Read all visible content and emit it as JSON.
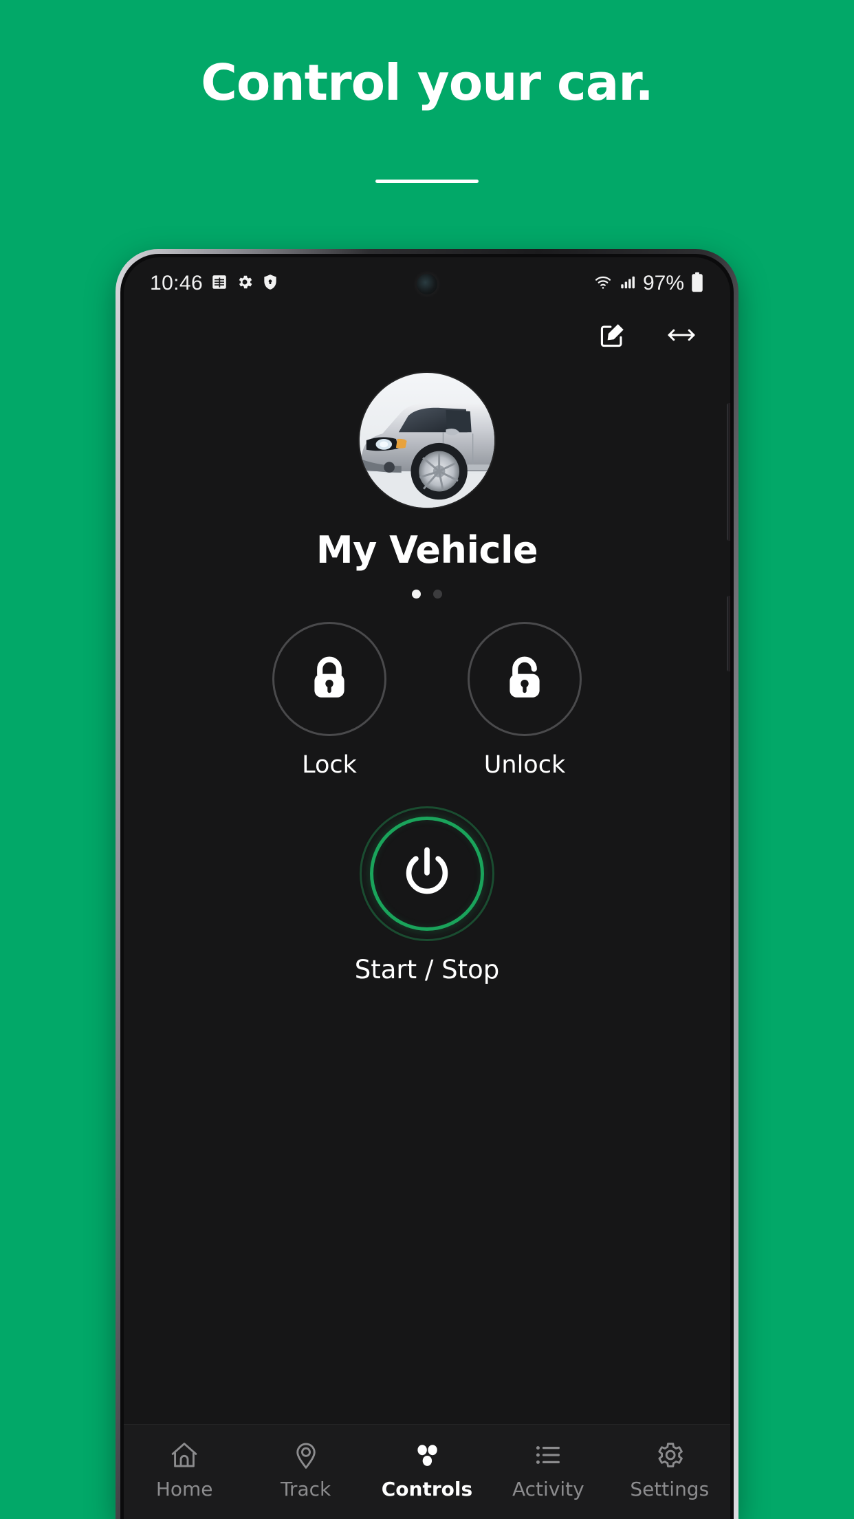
{
  "promo": {
    "title": "Control your car."
  },
  "phone": {
    "status_bar": {
      "clock": "10:46",
      "battery_percent": "97%",
      "left_icons": [
        "calendar-icon",
        "gear-icon",
        "shield-vpn-icon"
      ],
      "right_icons": [
        "wifi-icon",
        "cellular-signal-icon",
        "battery-icon"
      ]
    },
    "app_bar": {
      "edit_label": "edit-icon",
      "swap_label": "horizontal-arrows-icon"
    },
    "vehicle": {
      "name": "My Vehicle",
      "photo_alt": "silver-crossover-suv",
      "pagination": {
        "total": 2,
        "active_index": 0
      }
    },
    "controls": [
      {
        "id": "lock",
        "label": "Lock",
        "icon": "lock-closed-icon"
      },
      {
        "id": "unlock",
        "label": "Unlock",
        "icon": "lock-open-icon"
      }
    ],
    "power": {
      "label": "Start / Stop",
      "icon": "power-icon",
      "ring_color": "#1aa45b"
    },
    "bottom_nav": {
      "items": [
        {
          "id": "home",
          "label": "Home",
          "icon": "house-icon",
          "active": false
        },
        {
          "id": "track",
          "label": "Track",
          "icon": "map-pin-icon",
          "active": false
        },
        {
          "id": "controls",
          "label": "Controls",
          "icon": "dots-icon",
          "active": true
        },
        {
          "id": "activity",
          "label": "Activity",
          "icon": "list-icon",
          "active": false
        },
        {
          "id": "settings",
          "label": "Settings",
          "icon": "gear-icon",
          "active": false
        }
      ]
    }
  },
  "colors": {
    "brand_green": "#02a868",
    "screen_bg": "#161617",
    "accent_green": "#1aa45b",
    "nav_inactive": "#8c8c8e"
  }
}
